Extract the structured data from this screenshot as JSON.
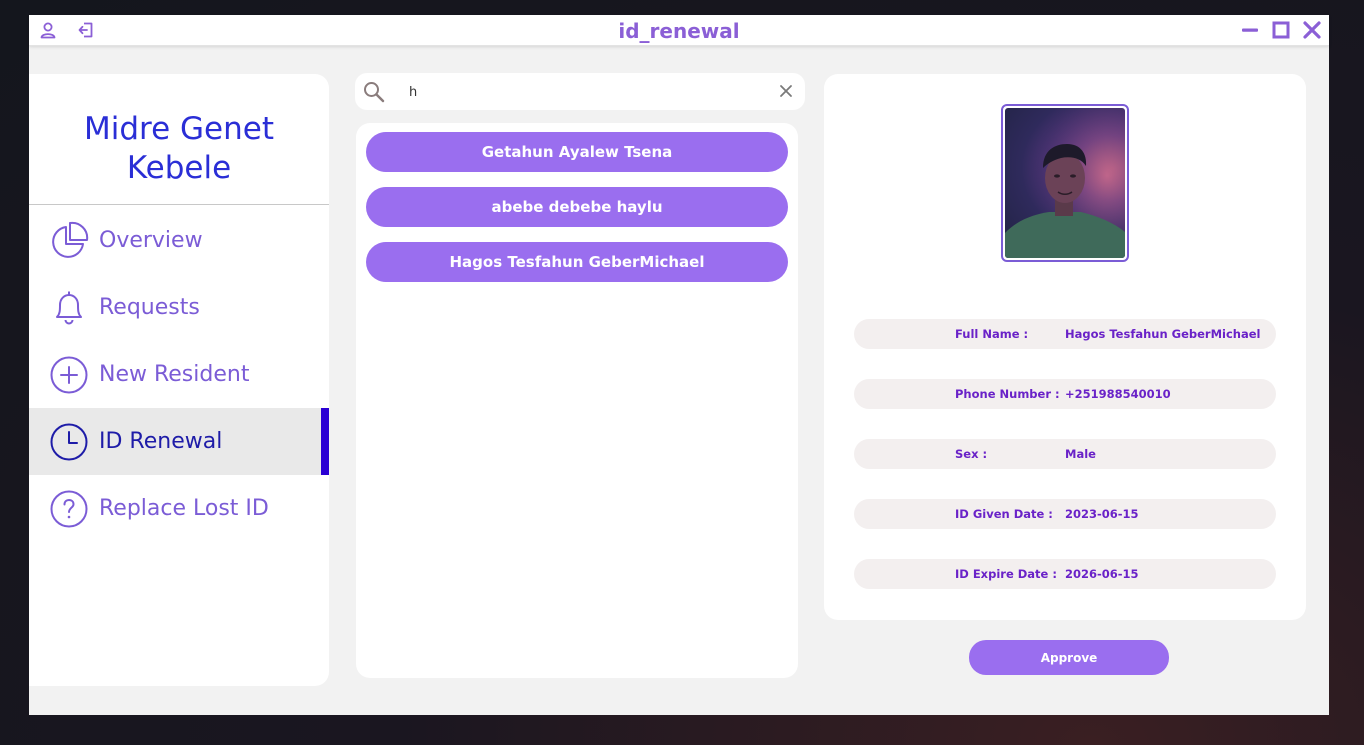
{
  "window": {
    "title": "id_renewal",
    "controls": [
      "minimize-icon",
      "maximize-icon",
      "close-icon"
    ],
    "left_icons": [
      "user-icon",
      "logout-icon"
    ]
  },
  "sidebar": {
    "brand": "Midre Genet Kebele",
    "items": [
      {
        "label": "Overview",
        "icon": "pie-chart-icon",
        "active": false
      },
      {
        "label": "Requests",
        "icon": "bell-icon",
        "active": false
      },
      {
        "label": "New Resident",
        "icon": "plus-circle-icon",
        "active": false
      },
      {
        "label": "ID Renewal",
        "icon": "clock-icon",
        "active": true
      },
      {
        "label": "Replace Lost ID",
        "icon": "help-circle-icon",
        "active": false
      }
    ]
  },
  "search": {
    "value": "h",
    "placeholder": ""
  },
  "results": [
    {
      "name": "Getahun Ayalew Tsena"
    },
    {
      "name": "abebe debebe haylu"
    },
    {
      "name": "Hagos Tesfahun GeberMichael"
    }
  ],
  "detail": {
    "fields": [
      {
        "label": "Full Name :",
        "value": "Hagos Tesfahun GeberMichael"
      },
      {
        "label": "Phone Number :",
        "value": "+251988540010"
      },
      {
        "label": "Sex :",
        "value": "Male"
      },
      {
        "label": "ID Given Date :",
        "value": "2023-06-15"
      },
      {
        "label": "ID Expire Date :",
        "value": "2026-06-15"
      }
    ]
  },
  "actions": {
    "approve_label": "Approve"
  },
  "colors": {
    "accent": "#9a6eef",
    "brand": "#2a2ed6",
    "active_indicator": "#2a00d4",
    "title": "#8b5fd6"
  }
}
